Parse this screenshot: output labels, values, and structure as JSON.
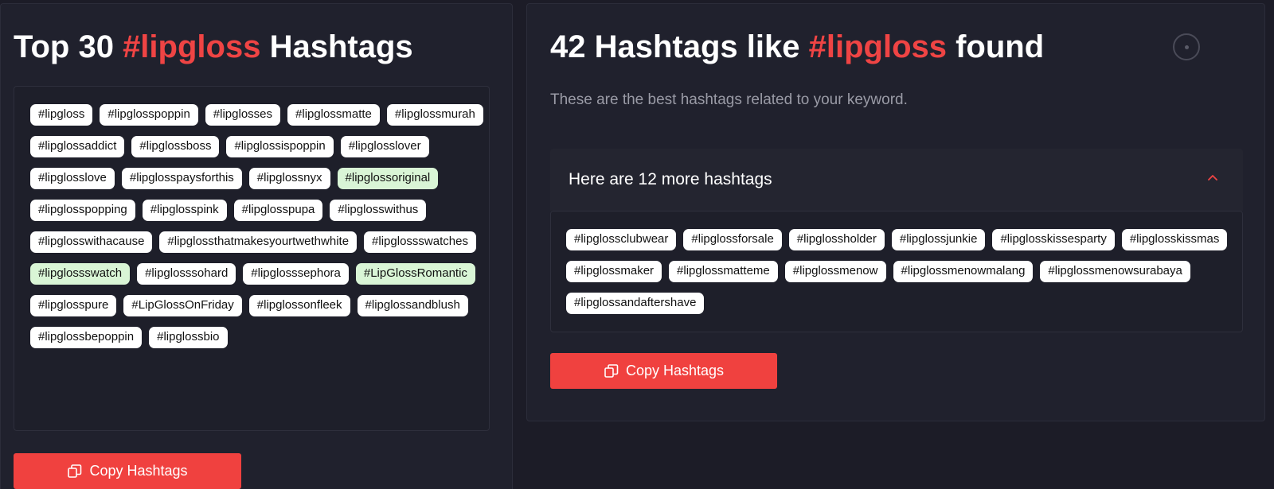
{
  "left": {
    "title_pre": "Top 30 ",
    "title_accent": "#lipgloss",
    "title_post": " Hashtags",
    "tags": [
      {
        "text": "#lipgloss",
        "hl": false
      },
      {
        "text": "#lipglosspoppin",
        "hl": false
      },
      {
        "text": "#lipglosses",
        "hl": false
      },
      {
        "text": "#lipglossmatte",
        "hl": false
      },
      {
        "text": "#lipglossmurah",
        "hl": false
      },
      {
        "text": "#lipglossaddict",
        "hl": false
      },
      {
        "text": "#lipglossboss",
        "hl": false
      },
      {
        "text": "#lipglossispoppin",
        "hl": false
      },
      {
        "text": "#lipglosslover",
        "hl": false
      },
      {
        "text": "#lipglosslove",
        "hl": false
      },
      {
        "text": "#lipglosspaysforthis",
        "hl": false
      },
      {
        "text": "#lipglossnyx",
        "hl": false
      },
      {
        "text": "#lipglossoriginal",
        "hl": true
      },
      {
        "text": "#lipglosspopping",
        "hl": false
      },
      {
        "text": "#lipglosspink",
        "hl": false
      },
      {
        "text": "#lipglosspupa",
        "hl": false
      },
      {
        "text": "#lipglosswithus",
        "hl": false
      },
      {
        "text": "#lipglosswithacause",
        "hl": false
      },
      {
        "text": "#lipglossthatmakesyourtwethwhite",
        "hl": false
      },
      {
        "text": "#lipglossswatches",
        "hl": false
      },
      {
        "text": "#lipglossswatch",
        "hl": true
      },
      {
        "text": "#lipglosssohard",
        "hl": false
      },
      {
        "text": "#lipglosssephora",
        "hl": false
      },
      {
        "text": "#LipGlossRomantic",
        "hl": true
      },
      {
        "text": "#lipglosspure",
        "hl": false
      },
      {
        "text": "#LipGlossOnFriday",
        "hl": false
      },
      {
        "text": "#lipglossonfleek",
        "hl": false
      },
      {
        "text": "#lipglossandblush",
        "hl": false
      },
      {
        "text": "#lipglossbepoppin",
        "hl": false
      },
      {
        "text": "#lipglossbio",
        "hl": false
      }
    ],
    "copy_label": "Copy Hashtags"
  },
  "right": {
    "title_pre": "42 Hashtags like ",
    "title_accent": "#lipgloss",
    "title_post": " found",
    "subtitle": "These are the best hashtags related to your keyword.",
    "accordion_label": "Here are 12 more hashtags",
    "tags": [
      {
        "text": "#lipglossclubwear",
        "hl": false
      },
      {
        "text": "#lipglossforsale",
        "hl": false
      },
      {
        "text": "#lipglossholder",
        "hl": false
      },
      {
        "text": "#lipglossjunkie",
        "hl": false
      },
      {
        "text": "#lipglosskissesparty",
        "hl": false
      },
      {
        "text": "#lipglosskissmas",
        "hl": false
      },
      {
        "text": "#lipglossmaker",
        "hl": false
      },
      {
        "text": "#lipglossmatteme",
        "hl": false
      },
      {
        "text": "#lipglossmenow",
        "hl": false
      },
      {
        "text": "#lipglossmenowmalang",
        "hl": false
      },
      {
        "text": "#lipglossmenowsurabaya",
        "hl": false
      },
      {
        "text": "#lipglossandaftershave",
        "hl": false
      }
    ],
    "copy_label": "Copy Hashtags"
  },
  "colors": {
    "accent": "#ef4444",
    "button": "#f0413f",
    "highlight_tag": "#d9f5d6",
    "background": "#1c1c27"
  },
  "icons": {
    "copy": "copy-icon",
    "chevron": "chevron-up-icon",
    "spinner": "loading-spinner-icon"
  }
}
